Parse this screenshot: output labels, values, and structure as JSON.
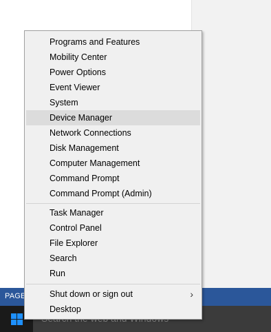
{
  "status_bar": {
    "text": "PAGE"
  },
  "taskbar": {
    "search_placeholder": "Search the web and Windows",
    "start_icon": "windows-logo-icon"
  },
  "context_menu": {
    "group1": [
      {
        "label": "Programs and Features"
      },
      {
        "label": "Mobility Center"
      },
      {
        "label": "Power Options"
      },
      {
        "label": "Event Viewer"
      },
      {
        "label": "System"
      },
      {
        "label": "Device Manager",
        "highlighted": true
      },
      {
        "label": "Network Connections"
      },
      {
        "label": "Disk Management"
      },
      {
        "label": "Computer Management"
      },
      {
        "label": "Command Prompt"
      },
      {
        "label": "Command Prompt (Admin)"
      }
    ],
    "group2": [
      {
        "label": "Task Manager"
      },
      {
        "label": "Control Panel"
      },
      {
        "label": "File Explorer"
      },
      {
        "label": "Search"
      },
      {
        "label": "Run"
      }
    ],
    "group3": [
      {
        "label": "Shut down or sign out",
        "submenu_icon": "chevron-right-icon"
      },
      {
        "label": "Desktop"
      }
    ]
  },
  "colors": {
    "status_bar": "#2b579a",
    "taskbar": "#1a1a1a",
    "windows_logo": "#1e90ff",
    "highlight": "#dcdcdc"
  }
}
